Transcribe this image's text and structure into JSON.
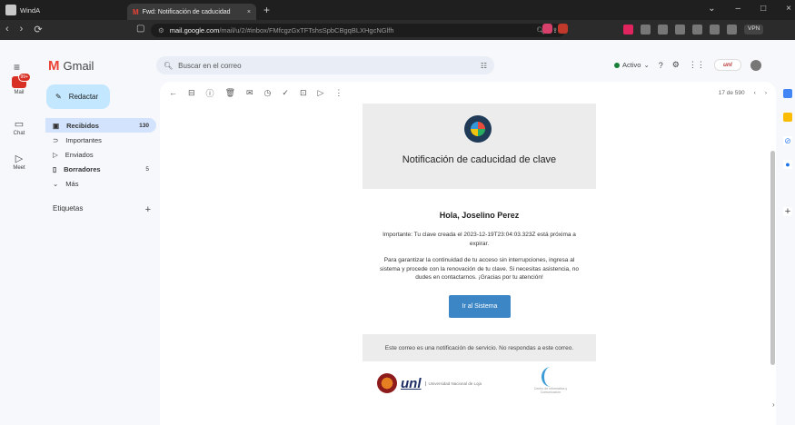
{
  "window": {
    "app_name": "WindA",
    "tab_title": "Fwd: Notificación de caducidad",
    "tab_close": "×",
    "new_tab": "+",
    "controls": [
      "⌄",
      "–",
      "□",
      "×"
    ]
  },
  "address_bar": {
    "secure_icon": "tune-icon",
    "domain": "mail.google.com",
    "path": "/mail/u/2/#inbox/FMfcgzGxTFTshsSpbCBgqBLXHgcNGlfh",
    "vpn_label": "VPN"
  },
  "gmail": {
    "logo_text": "Gmail",
    "search_placeholder": "Buscar en el correo",
    "status_label": "Activo",
    "status_color": "#188038",
    "account_badge": "unl",
    "compose_label": "Redactar",
    "rail": {
      "mail_label": "Mail",
      "mail_badge": "99+",
      "chat_label": "Chat",
      "meet_label": "Meet"
    },
    "nav": [
      {
        "label": "Recibidos",
        "count": "130",
        "icon": "inbox-icon",
        "active": true
      },
      {
        "label": "Importantes",
        "count": "",
        "icon": "important-icon",
        "active": false
      },
      {
        "label": "Enviados",
        "count": "",
        "icon": "sent-icon",
        "active": false
      },
      {
        "label": "Borradores",
        "count": "5",
        "icon": "draft-icon",
        "active": false
      },
      {
        "label": "Más",
        "count": "",
        "icon": "chevron-down-icon",
        "active": false
      }
    ],
    "labels_title": "Etiquetas",
    "pagination": "17 de 590"
  },
  "email": {
    "title": "Notificación de caducidad de clave",
    "greeting": "Hola, Joselino Perez",
    "paragraph1": "Importante: Tu clave creada el 2023-12-19T23:04:03.323Z está próxima a expirar.",
    "paragraph2": "Para garantizar la continuidad de tu acceso sin interrupciones, ingresa al sistema y procede con la renovación de tu clave. Si necesitas asistencia, no dudes en contactarnos. ¡Gracias por tu atención!",
    "button_label": "Ir al Sistema",
    "button_color": "#3d86c6",
    "footer": "Este correo es una notificación de servicio. No respondas a este correo.",
    "unl_logo_text": "unl",
    "unl_logo_small": "Universidad Nacional de Loja",
    "cic_logo_small": "Centro de Informática y Comunicación"
  }
}
